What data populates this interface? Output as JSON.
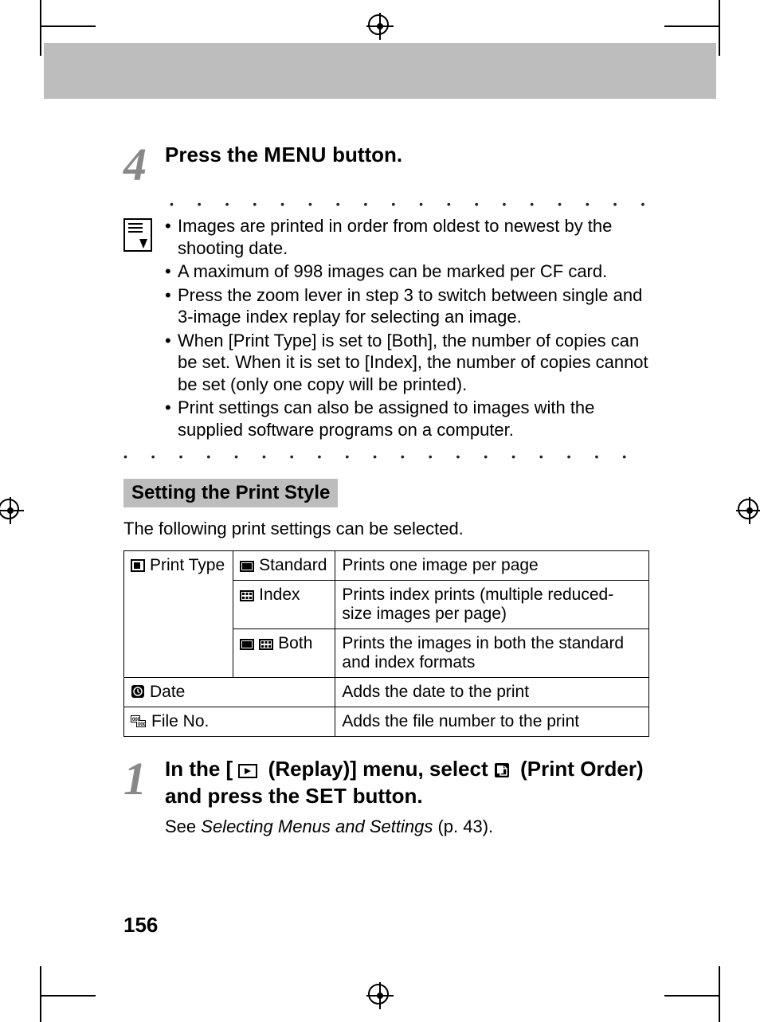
{
  "page_number": "156",
  "step4": {
    "number": "4",
    "prefix": "Press the ",
    "menu_word": "MENU",
    "suffix": " button."
  },
  "notes": [
    "Images are printed in order from oldest to newest by the shooting date.",
    "A maximum of 998 images can be marked per CF card.",
    "Press the zoom lever in step 3 to switch between single and 3-image index replay for selecting an image.",
    "When [Print Type] is set to [Both], the number of copies can be set. When it is set to [Index], the number of copies cannot be set (only one copy will be printed).",
    "Print settings can also be assigned to images with the supplied software programs on a computer."
  ],
  "section": {
    "title": "Setting the Print Style",
    "intro": "The following print settings can be selected."
  },
  "table": {
    "print_type_label": "Print Type",
    "rows": {
      "standard": {
        "name": "Standard",
        "desc": "Prints one image per page"
      },
      "index": {
        "name": "Index",
        "desc": "Prints index prints (multiple reduced-size images per page)"
      },
      "both": {
        "name": "Both",
        "desc": "Prints the images in both the standard and index formats"
      }
    },
    "date": {
      "name": "Date",
      "desc": "Adds the date to the print"
    },
    "file_no": {
      "name": "File No.",
      "desc": "Adds the file number to the print"
    }
  },
  "step1": {
    "number": "1",
    "part1": "In the [ ",
    "replay": " (Replay)] menu, select ",
    "print_order": " (Print Order) and press the ",
    "set_word": "SET",
    "part_end": " button.",
    "sub_pre": "See ",
    "sub_ital": "Selecting Menus and Settings",
    "sub_post": " (p. 43)."
  },
  "dots": "• • • • • • • • • • • • • • • • • • • • • • • • • • • • • • • •"
}
